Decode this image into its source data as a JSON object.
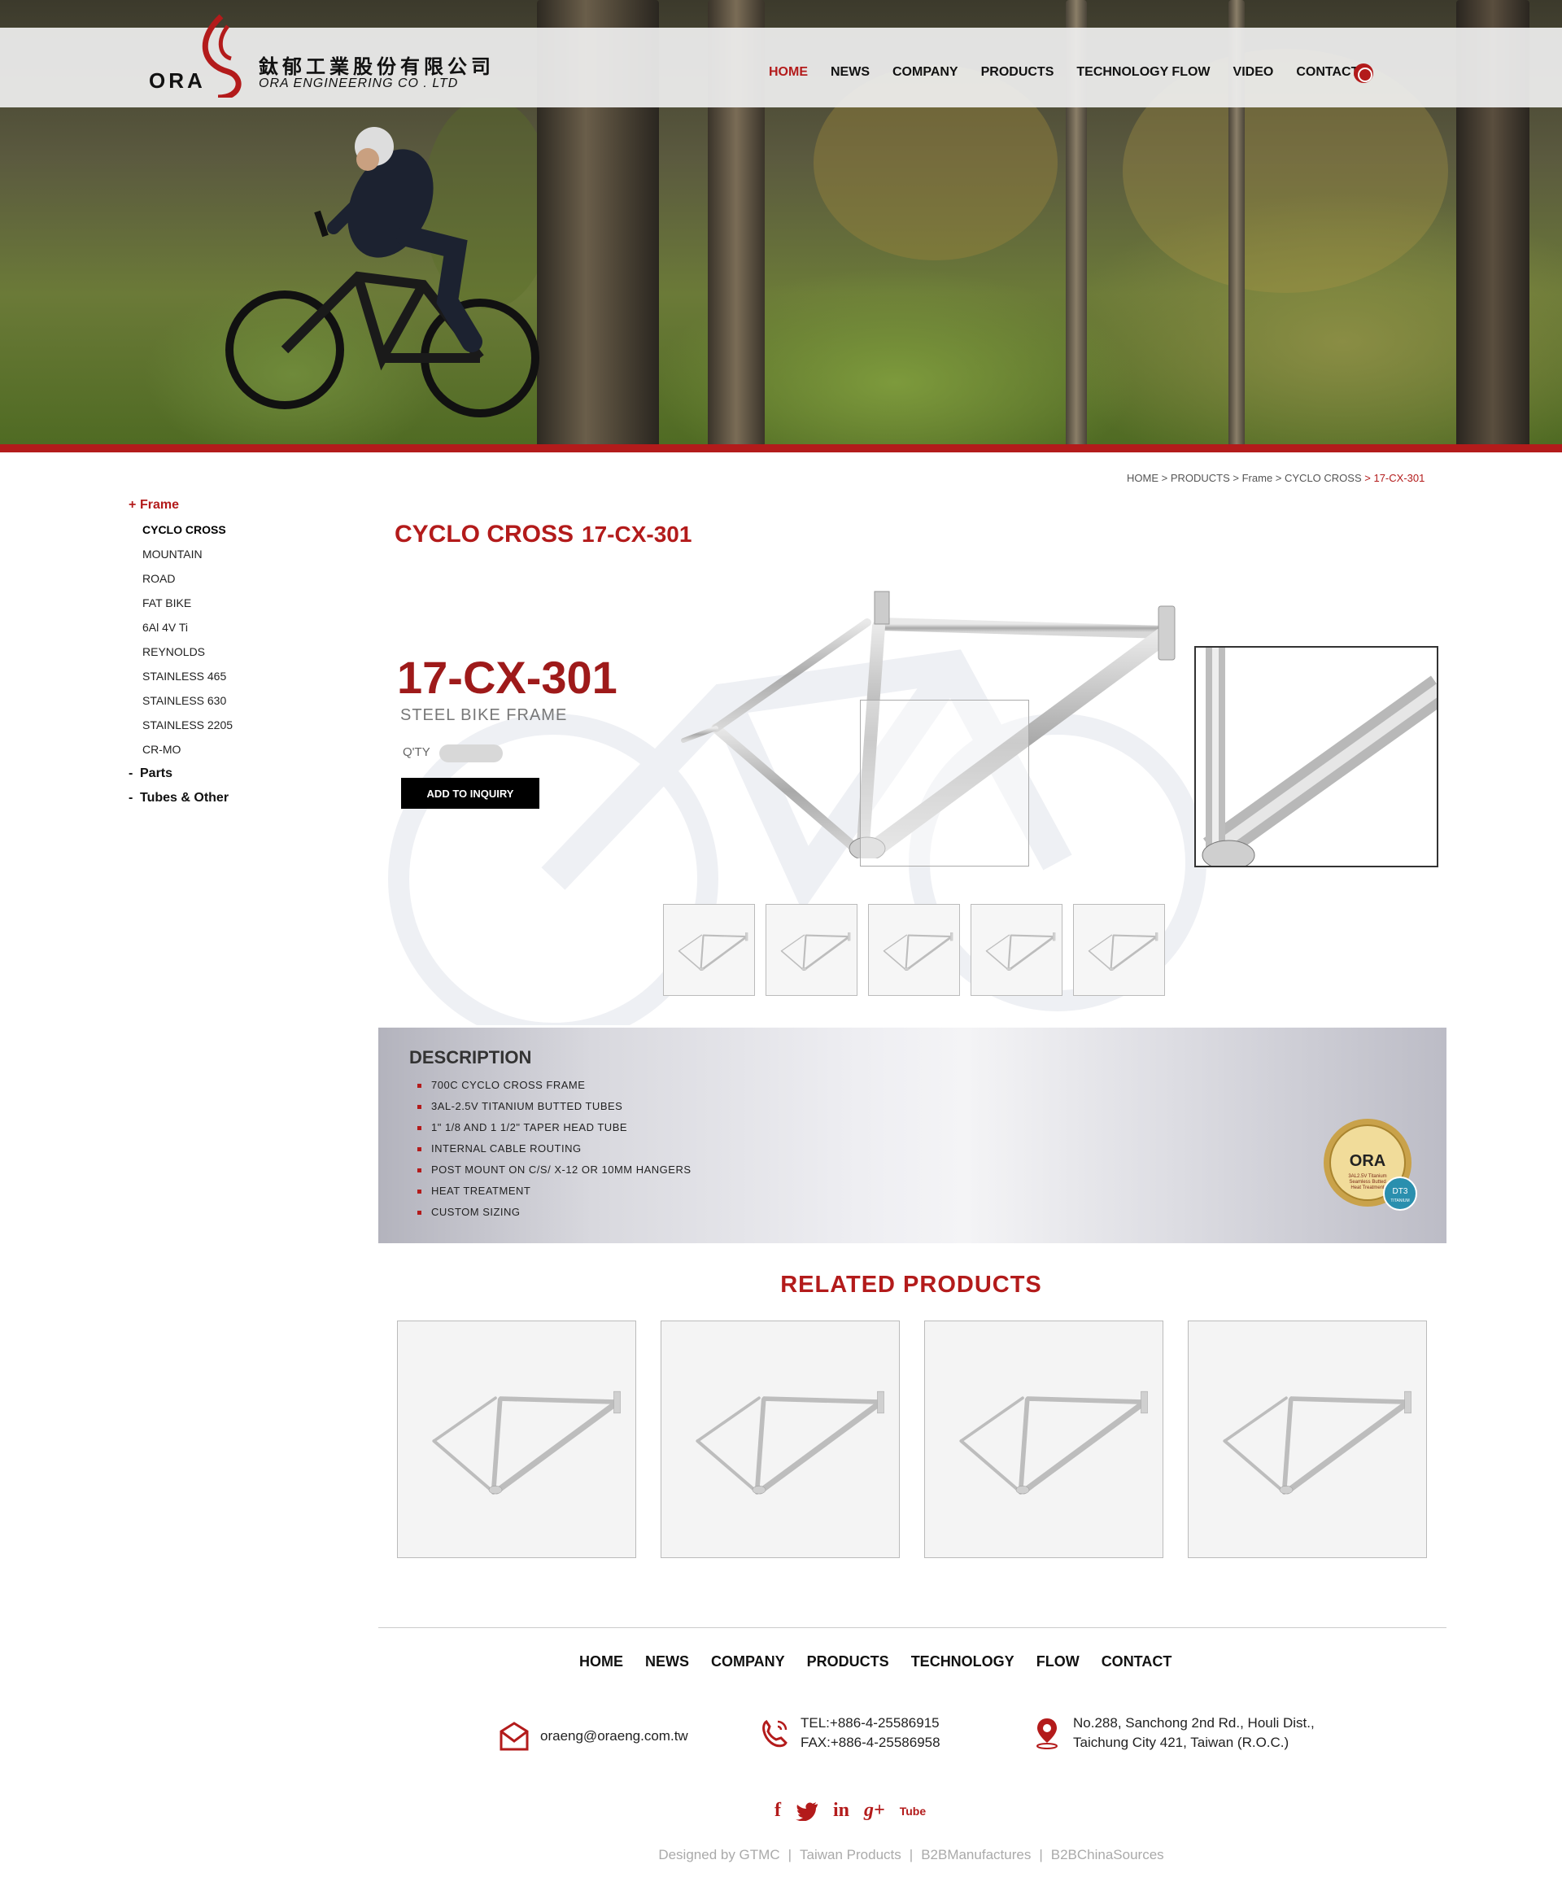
{
  "brand": {
    "logo_text": "ORA",
    "name_cn": "鈦郁工業股份有限公司",
    "name_en": "ORA ENGINEERING CO . LTD",
    "accent_color": "#b31b1b"
  },
  "nav": {
    "items": [
      "HOME",
      "NEWS",
      "COMPANY",
      "PRODUCTS",
      "TECHNOLOGY FLOW",
      "VIDEO",
      "CONTACT"
    ],
    "active": "HOME",
    "language_icon": "globe-icon"
  },
  "sidebar": {
    "categories": [
      {
        "mark": "+",
        "label": "Frame",
        "open": true,
        "items": [
          "CYCLO CROSS",
          "MOUNTAIN",
          "ROAD",
          "FAT BIKE",
          "6Al 4V Ti",
          "REYNOLDS",
          "STAINLESS 465",
          "STAINLESS 630",
          "STAINLESS 2205",
          "CR-MO"
        ],
        "active": "CYCLO CROSS"
      },
      {
        "mark": "-",
        "label": "Parts",
        "open": false
      },
      {
        "mark": "-",
        "label": "Tubes & Other",
        "open": false
      }
    ]
  },
  "breadcrumb": {
    "parts": [
      "HOME",
      "PRODUCTS",
      "Frame",
      "CYCLO CROSS"
    ],
    "current": "17-CX-301"
  },
  "page": {
    "title": "CYCLO CROSS",
    "code": "17-CX-301"
  },
  "product": {
    "code": "17-CX-301",
    "subtitle": "STEEL BIKE FRAME",
    "qty_label": "Q'TY",
    "qty_value": "",
    "add_button": "ADD TO INQUIRY",
    "thumbnail_count": 5
  },
  "description": {
    "title": "DESCRIPTION",
    "items": [
      "700C CYCLO CROSS FRAME",
      "3AL-2.5V TITANIUM BUTTED TUBES",
      "1\" 1/8 AND 1 1/2\" TAPER HEAD TUBE",
      "INTERNAL CABLE ROUTING",
      "POST MOUNT ON C/S/ X-12 OR 10MM HANGERS",
      "HEAT TREATMENT",
      "CUSTOM SIZING"
    ],
    "badge": {
      "logo": "ORA",
      "ring_text": "THE HIGHEST QUALITY · HAND CRAFTED",
      "line1": "3AL2.5V Titanium",
      "line2": "Seamless Butted",
      "line3": "Heat Treatment",
      "tag": "DT3",
      "tag_sub": "TITANIUM"
    }
  },
  "related": {
    "title": "RELATED PRODUCTS",
    "count": 4
  },
  "footer": {
    "nav": [
      "HOME",
      "NEWS",
      "COMPANY",
      "PRODUCTS",
      "TECHNOLOGY",
      "FLOW",
      "CONTACT"
    ],
    "email": "oraeng@oraeng.com.tw",
    "tel": "TEL:+886-4-25586915",
    "fax": "FAX:+886-4-25586958",
    "address_line1": "No.288, Sanchong 2nd Rd., Houli Dist.,",
    "address_line2": "Taichung City 421, Taiwan (R.O.C.)",
    "social": [
      "f",
      "twitter",
      "in",
      "g+",
      "Tube"
    ],
    "credits": [
      "Designed by GTMC",
      "Taiwan Products",
      "B2BManufactures",
      "B2BChinaSources"
    ]
  }
}
